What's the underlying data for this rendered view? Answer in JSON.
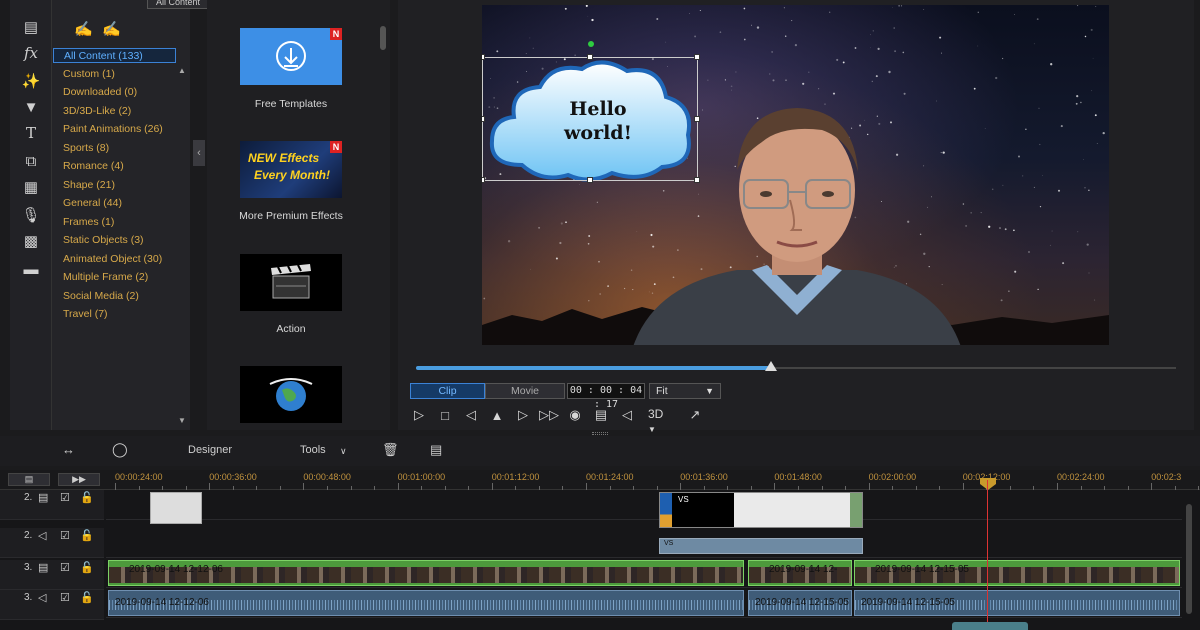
{
  "library": {
    "content_filter": "All Content",
    "categories": [
      {
        "label": "All Content (133)",
        "selected": true
      },
      {
        "label": "Custom  (1)"
      },
      {
        "label": "Downloaded  (0)"
      },
      {
        "label": "3D/3D-Like  (2)"
      },
      {
        "label": "Paint Animations  (26)"
      },
      {
        "label": "Sports  (8)"
      },
      {
        "label": "Romance  (4)"
      },
      {
        "label": "Shape  (21)"
      },
      {
        "label": "General  (44)"
      },
      {
        "label": "Frames  (1)"
      },
      {
        "label": "Static Objects  (3)"
      },
      {
        "label": "Animated Object  (30)"
      },
      {
        "label": "Multiple Frame  (2)"
      },
      {
        "label": "Social Media  (2)"
      },
      {
        "label": "Travel  (7)"
      }
    ],
    "templates": [
      {
        "label": "Free Templates",
        "badge": "N",
        "icon": "download-icon"
      },
      {
        "label": "More Premium Effects",
        "badge": "N",
        "thumb_text_1": "NEW Effects",
        "thumb_text_2": "Every Month!"
      },
      {
        "label": "Action",
        "icon": "clapperboard-icon"
      },
      {
        "label": "",
        "icon": "globe-icon"
      }
    ]
  },
  "preview": {
    "cloud_text_1": "Hello",
    "cloud_text_2": "world!",
    "progress": 0.467,
    "mode_clip": "Clip",
    "mode_movie": "Movie",
    "active_mode": "Clip",
    "timecode": "00 : 00 : 04 : 17",
    "zoom": "Fit",
    "label_3d": "3D"
  },
  "timeline_toolbar": {
    "designer": "Designer",
    "tools": "Tools"
  },
  "ruler": {
    "labels": [
      "00:00:24:00",
      "00:00:36:00",
      "00:00:48:00",
      "00:01:00:00",
      "00:01:12:00",
      "00:01:24:00",
      "00:01:36:00",
      "00:01:48:00",
      "00:02:00:00",
      "00:02:12:00",
      "00:02:24:00",
      "00:02:3"
    ]
  },
  "tracks": {
    "track2_video_num": "2.",
    "track2_audio_num": "2.",
    "track3_video_num": "3.",
    "track3_audio_num": "3.",
    "clip_vs_1": "VS",
    "clip_vs_2": "VS",
    "video_clips": [
      "2019-09-14 12-12-06",
      "2019-09-14 12-",
      "2019-09-14 12-15-05"
    ],
    "audio_clips": [
      "2019-09-14 12-12-06",
      "2019-09-14 12-15-05",
      "2019-09-14 12-15-05"
    ]
  },
  "colors": {
    "accent": "#3b82d6",
    "category_text": "#d7a94a",
    "video_clip": "#4d9a3c",
    "playhead": "#dd3333"
  }
}
